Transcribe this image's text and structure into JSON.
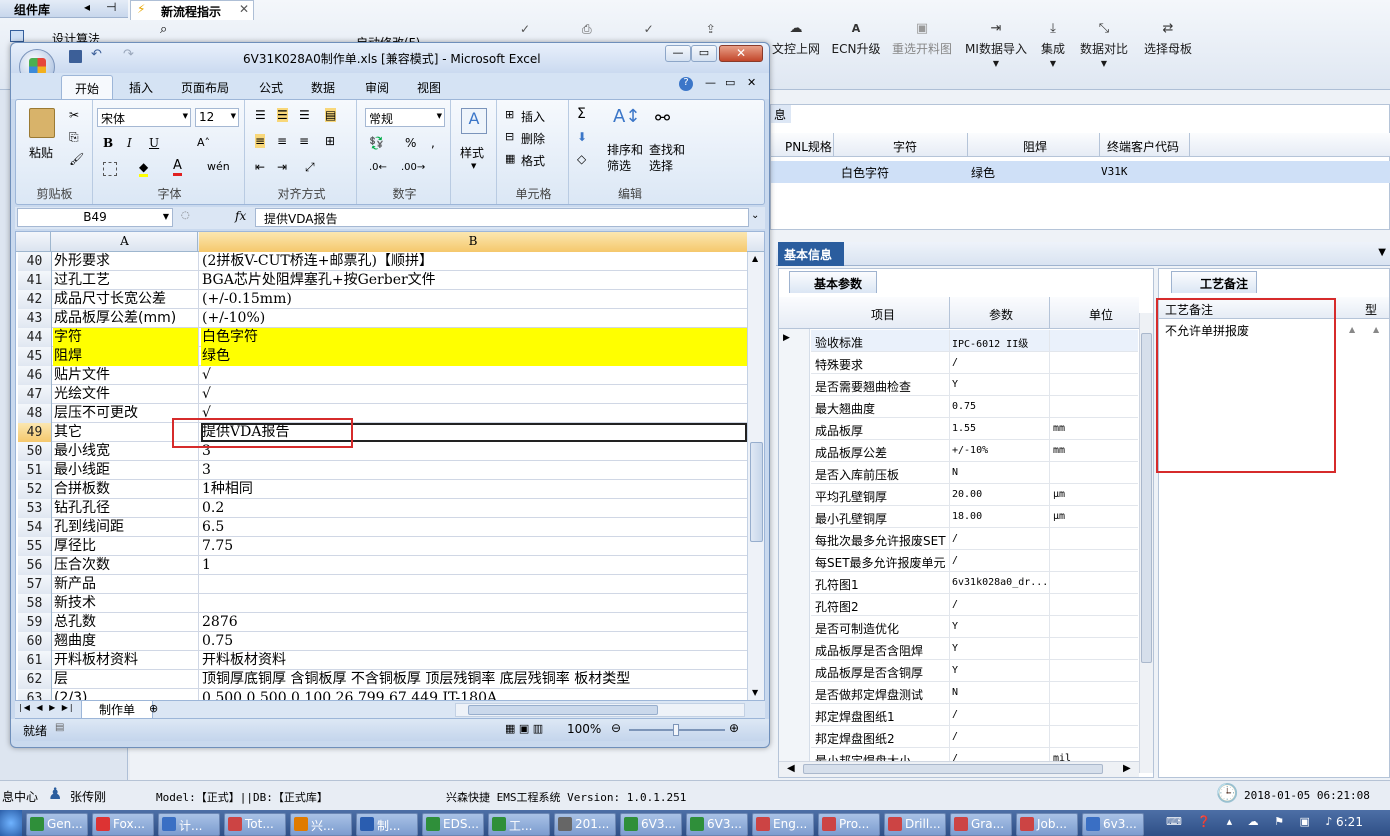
{
  "colors": {
    "accent": "#1f5fa6",
    "excel_title": "#dce8f6",
    "highlight_yellow": "#ffff00",
    "annotation_red": "#d62b2b",
    "selected_row": "#cfe0f7"
  },
  "left_panel": {
    "title": "组件库",
    "item1": "设计算法"
  },
  "doc_tab": {
    "label": "新流程指示"
  },
  "toolbar": {
    "partial_label": "启动修改(F)",
    "buttons": [
      {
        "label": "文控上网",
        "icon": "upload-icon"
      },
      {
        "label": "ECN升级",
        "icon": "ecn-icon"
      },
      {
        "label": "重选开料图",
        "icon": "image-icon"
      },
      {
        "label": "MI数据导入",
        "icon": "import-icon"
      },
      {
        "label": "集成",
        "icon": "integrate-icon"
      },
      {
        "label": "数据对比",
        "icon": "compare-icon"
      },
      {
        "label": "选择母板",
        "icon": "shuffle-icon"
      }
    ]
  },
  "right_grid": {
    "section_partial": "息",
    "headers": [
      "PNL规格",
      "字符",
      "阻焊",
      "终端客户代码"
    ],
    "row": [
      "",
      "白色字符",
      "绿色",
      "V31K"
    ]
  },
  "basic_info": {
    "tab": "基本信息",
    "subtab": "基本参数",
    "headers": [
      "项目",
      "参数",
      "单位"
    ],
    "rows": [
      [
        "验收标准",
        "IPC-6012 II级",
        ""
      ],
      [
        "特殊要求",
        "/",
        ""
      ],
      [
        "是否需要翘曲检查",
        "Y",
        ""
      ],
      [
        "最大翘曲度",
        "0.75",
        ""
      ],
      [
        "成品板厚",
        "1.55",
        "mm"
      ],
      [
        "成品板厚公差",
        "+/-10%",
        "mm"
      ],
      [
        "是否入库前压板",
        "N",
        ""
      ],
      [
        "平均孔壁铜厚",
        "20.00",
        "μm"
      ],
      [
        "最小孔壁铜厚",
        "18.00",
        "μm"
      ],
      [
        "每批次最多允许报废SET",
        "/",
        ""
      ],
      [
        "每SET最多允许报废单元",
        "/",
        ""
      ],
      [
        "孔符图1",
        "6v31k028a0_dr...",
        ""
      ],
      [
        "孔符图2",
        "/",
        ""
      ],
      [
        "是否可制造优化",
        "Y",
        ""
      ],
      [
        "成品板厚是否含阻焊",
        "Y",
        ""
      ],
      [
        "成品板厚是否含铜厚",
        "Y",
        ""
      ],
      [
        "是否做邦定焊盘测试",
        "N",
        ""
      ],
      [
        "邦定焊盘图纸1",
        "/",
        ""
      ],
      [
        "邦定焊盘图纸2",
        "/",
        ""
      ],
      [
        "最小邦定焊盘大小",
        "/",
        "mil"
      ]
    ]
  },
  "process_notes": {
    "tab": "工艺备注",
    "header": "工艺备注",
    "header2": "型",
    "text": "不允许单拼报废"
  },
  "excel": {
    "title": "6V31K028A0制作单.xls  [兼容模式] - Microsoft Excel",
    "ribbon_tabs": [
      "开始",
      "插入",
      "页面布局",
      "公式",
      "数据",
      "审阅",
      "视图"
    ],
    "paste": "粘贴",
    "font_name": "宋体",
    "font_size": "12",
    "number_format": "常规",
    "style_label": "样式",
    "insert_label": "插入",
    "delete_label": "删除",
    "format_label": "格式",
    "sort_label": "排序和\n筛选",
    "find_label": "查找和\n选择",
    "groups": [
      "剪贴板",
      "字体",
      "对齐方式",
      "数字",
      "单元格",
      "编辑"
    ],
    "name_box": "B49",
    "formula": "提供VDA报告",
    "col_a": "A",
    "col_b": "B",
    "rows": [
      [
        "40",
        "外形要求",
        "(2拼板V-CUT桥连+邮票孔)【顺拼】"
      ],
      [
        "41",
        "过孔工艺",
        "BGA芯片处阻焊塞孔+按Gerber文件"
      ],
      [
        "42",
        "成品尺寸长宽公差",
        "(+/-0.15mm)"
      ],
      [
        "43",
        "成品板厚公差(mm)",
        "(+/-10%)"
      ],
      [
        "44",
        "字符",
        "白色字符"
      ],
      [
        "45",
        "阻焊",
        "绿色"
      ],
      [
        "46",
        "贴片文件",
        "√"
      ],
      [
        "47",
        "光绘文件",
        "√"
      ],
      [
        "48",
        "层压不可更改",
        "√"
      ],
      [
        "49",
        "其它",
        "提供VDA报告"
      ],
      [
        "50",
        "最小线宽",
        "3"
      ],
      [
        "51",
        "最小线距",
        "3"
      ],
      [
        "52",
        "合拼板数",
        "1种相同"
      ],
      [
        "53",
        "钻孔孔径",
        "0.2"
      ],
      [
        "54",
        "孔到线间距",
        "6.5"
      ],
      [
        "55",
        "厚径比",
        "7.75"
      ],
      [
        "56",
        "压合次数",
        "1"
      ],
      [
        "57",
        "新产品",
        ""
      ],
      [
        "58",
        "新技术",
        ""
      ],
      [
        "59",
        "总孔数",
        "2876"
      ],
      [
        "60",
        "翘曲度",
        "0.75"
      ],
      [
        "61",
        "开料板材资料",
        "开料板材资料"
      ],
      [
        "62",
        "层",
        "顶铜厚底铜厚 含铜板厚 不含铜板厚 顶层残铜率 底层残铜率 板材类型"
      ],
      [
        "63",
        "(2/3)",
        "0.500  0.500        0.100     26.799    67.449      IT-180A"
      ]
    ],
    "sheet_tab": "制作单",
    "status": "就绪",
    "zoom": "100%"
  },
  "statusbar": {
    "left": "息中心",
    "user": "张传刚",
    "model": "Model:【正式】||DB:【正式库】",
    "system": "兴森快捷 EMS工程系统 Version: 1.0.1.251",
    "datetime": "2018-01-05 06:21:08"
  },
  "taskbar": {
    "items": [
      {
        "label": "Gen...",
        "color": "#2f8f3a"
      },
      {
        "label": "Fox...",
        "color": "#d33"
      },
      {
        "label": "计...",
        "color": "#3a6fc4"
      },
      {
        "label": "Tot...",
        "color": "#c44"
      },
      {
        "label": "兴...",
        "color": "#e07b00"
      },
      {
        "label": "制...",
        "color": "#2a5db0"
      },
      {
        "label": "EDS...",
        "color": "#2f8f3a"
      },
      {
        "label": "工...",
        "color": "#2f8f3a"
      },
      {
        "label": "201...",
        "color": "#666"
      },
      {
        "label": "6V3...",
        "color": "#2f8f3a"
      },
      {
        "label": "6V3...",
        "color": "#2f8f3a"
      },
      {
        "label": "Eng...",
        "color": "#c44"
      },
      {
        "label": "Pro...",
        "color": "#c44"
      },
      {
        "label": "Drill...",
        "color": "#c44"
      },
      {
        "label": "Gra...",
        "color": "#c44"
      },
      {
        "label": "Job...",
        "color": "#c44"
      },
      {
        "label": "6v3...",
        "color": "#3a6fc4"
      }
    ],
    "clock": "6:21"
  }
}
